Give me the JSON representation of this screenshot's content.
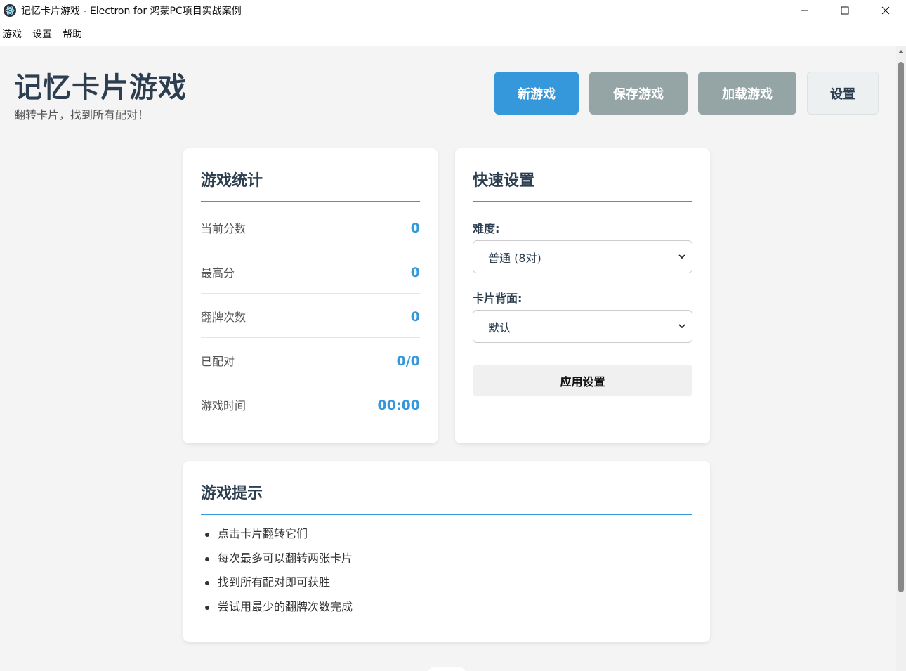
{
  "window": {
    "title": "记忆卡片游戏 - Electron for 鸿蒙PC项目实战案例"
  },
  "menu": [
    "游戏",
    "设置",
    "帮助"
  ],
  "header": {
    "title": "记忆卡片游戏",
    "subtitle": "翻转卡片，找到所有配对！",
    "buttons": {
      "new_game": "新游戏",
      "save_game": "保存游戏",
      "load_game": "加载游戏",
      "settings": "设置"
    }
  },
  "stats": {
    "title": "游戏统计",
    "rows": [
      {
        "label": "当前分数",
        "value": "0"
      },
      {
        "label": "最高分",
        "value": "0"
      },
      {
        "label": "翻牌次数",
        "value": "0"
      },
      {
        "label": "已配对",
        "value": "0/0"
      },
      {
        "label": "游戏时间",
        "value": "00:00"
      }
    ]
  },
  "quick_settings": {
    "title": "快速设置",
    "difficulty_label": "难度:",
    "difficulty_value": "普通 (8对)",
    "card_back_label": "卡片背面:",
    "card_back_value": "默认",
    "apply_label": "应用设置"
  },
  "tips": {
    "title": "游戏提示",
    "items": [
      "点击卡片翻转它们",
      "每次最多可以翻转两张卡片",
      "找到所有配对即可获胜",
      "尝试用最少的翻牌次数完成"
    ]
  },
  "colors": {
    "accent": "#3498db",
    "secondary": "#95a5a6",
    "heading": "#2c3e50"
  }
}
